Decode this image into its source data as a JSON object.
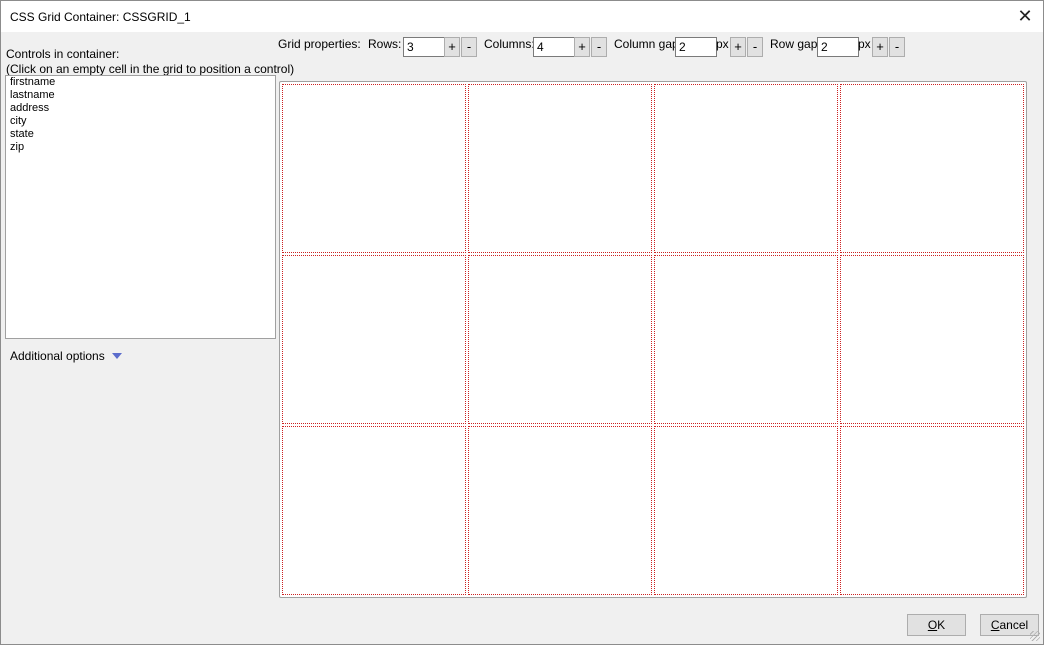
{
  "window": {
    "title": "CSS Grid Container: CSSGRID_1"
  },
  "left": {
    "controls_label": "Controls in container:",
    "hint": "(Click on an empty cell in the grid to position a control)",
    "controls": [
      "firstname",
      "lastname",
      "address",
      "city",
      "state",
      "zip"
    ],
    "additional_options": "Additional options"
  },
  "props": {
    "label": "Grid properties:",
    "rows_label": "Rows:",
    "rows": "3",
    "columns_label": "Columns:",
    "columns": "4",
    "colgap_label": "Column gap",
    "colgap": "2",
    "rowgap_label": "Row gap",
    "rowgap": "2",
    "unit": "px",
    "plus": "+",
    "minus": "-"
  },
  "grid": {
    "rows": 3,
    "columns": 4,
    "cell_border_color": "#cc2222"
  },
  "buttons": {
    "ok_prefix": "O",
    "ok_rest": "K",
    "cancel_prefix": "C",
    "cancel_rest": "ancel"
  }
}
